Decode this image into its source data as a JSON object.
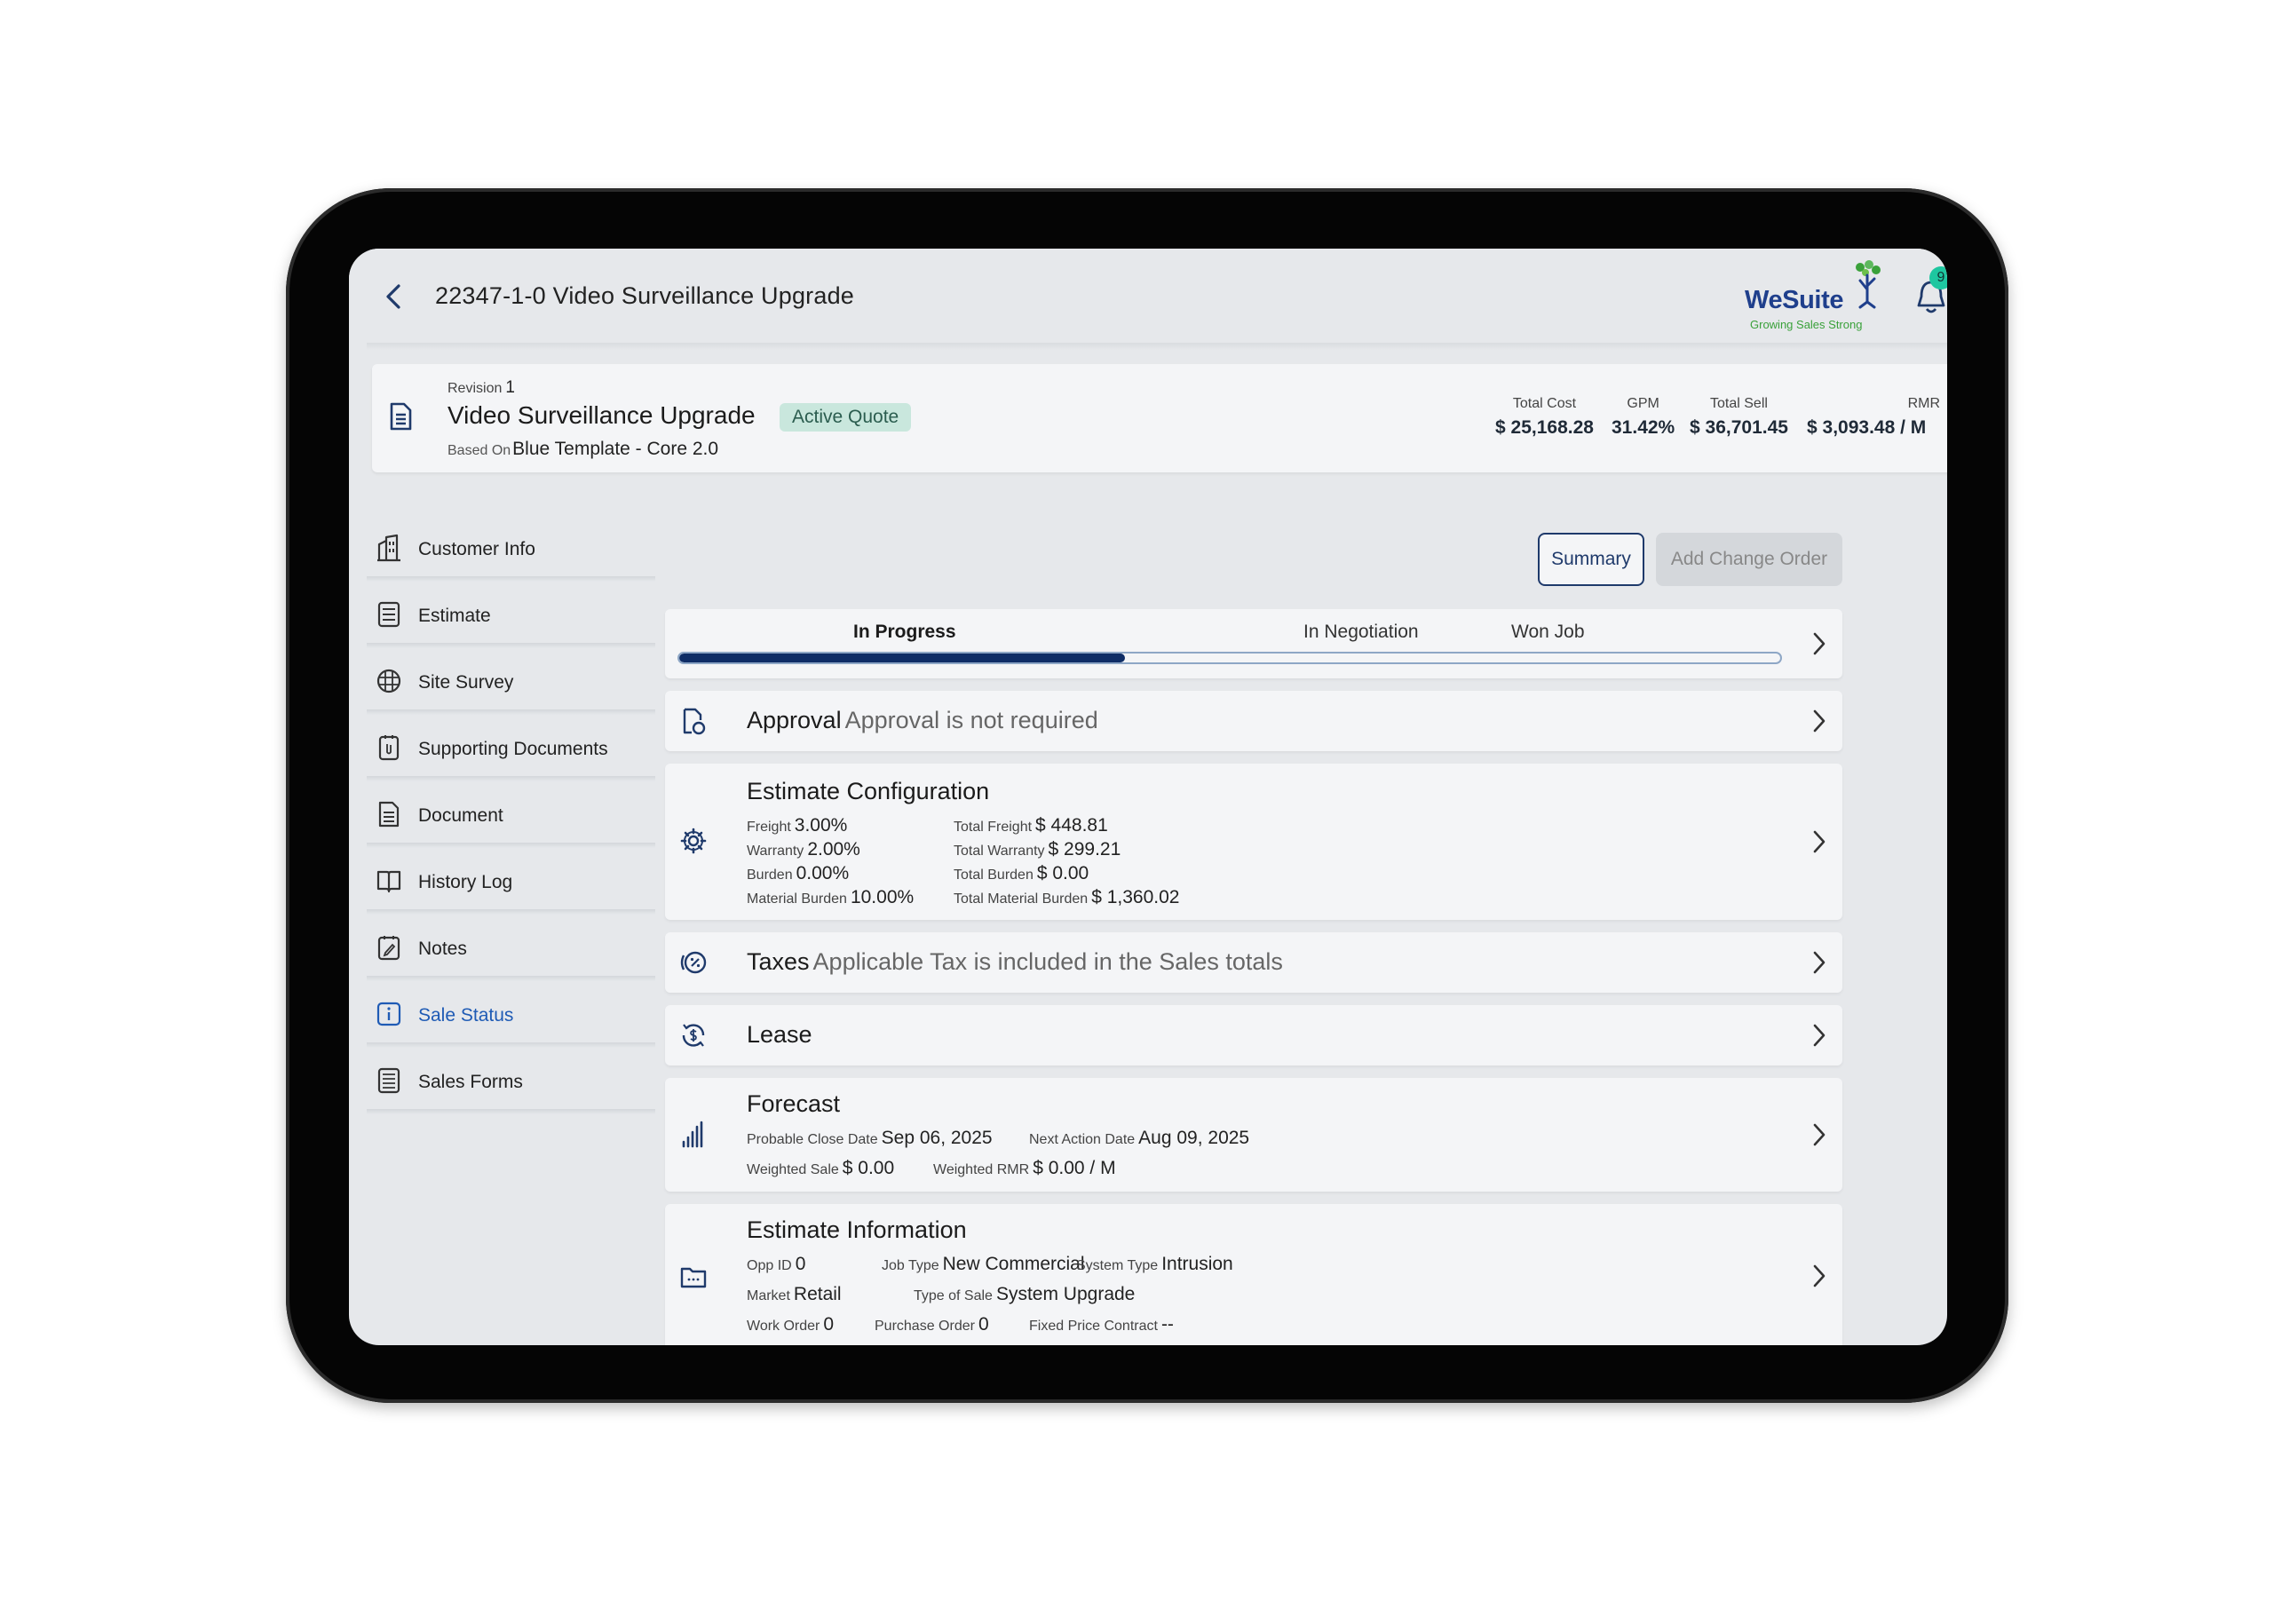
{
  "header": {
    "title": "22347-1-0 Video Surveillance Upgrade",
    "logo_name": "WeSuite",
    "logo_tagline": "Growing Sales Strong",
    "notification_count": "9"
  },
  "revision": {
    "label": "Revision",
    "number": "1",
    "name": "Video Surveillance Upgrade",
    "status_badge": "Active Quote",
    "based_on_label": "Based On",
    "based_on_value": "Blue Template - Core 2.0",
    "totals": [
      {
        "label": "Total Cost",
        "value": "$ 25,168.28"
      },
      {
        "label": "GPM",
        "value": "31.42%"
      },
      {
        "label": "Total Sell",
        "value": "$ 36,701.45"
      },
      {
        "label": "RMR",
        "value": "$ 3,093.48 / M"
      }
    ]
  },
  "sidebar": {
    "items": [
      {
        "label": "Customer Info",
        "icon": "building-icon"
      },
      {
        "label": "Estimate",
        "icon": "calculator-icon"
      },
      {
        "label": "Site Survey",
        "icon": "globe-grid-icon"
      },
      {
        "label": "Supporting Documents",
        "icon": "paperclip-document-icon"
      },
      {
        "label": "Document",
        "icon": "document-icon"
      },
      {
        "label": "History Log",
        "icon": "book-icon"
      },
      {
        "label": "Notes",
        "icon": "notepad-icon"
      },
      {
        "label": "Sale Status",
        "icon": "info-icon"
      },
      {
        "label": "Sales Forms",
        "icon": "form-icon"
      }
    ],
    "active_index": 7
  },
  "actions": {
    "summary_label": "Summary",
    "change_order_label": "Add Change Order"
  },
  "progress": {
    "stages": [
      "In Progress",
      "In Negotiation",
      "Won Job"
    ],
    "current_stage": "In Progress",
    "fill_fraction": 0.405
  },
  "cards": {
    "approval": {
      "title": "Approval",
      "subtitle": "Approval is not required"
    },
    "estimate_config": {
      "title": "Estimate Configuration",
      "left": [
        {
          "k": "Freight",
          "v": "3.00%"
        },
        {
          "k": "Warranty",
          "v": "2.00%"
        },
        {
          "k": "Burden",
          "v": "0.00%"
        },
        {
          "k": "Material Burden",
          "v": "10.00%"
        }
      ],
      "right": [
        {
          "k": "Total Freight",
          "v": "$ 448.81"
        },
        {
          "k": "Total Warranty",
          "v": "$ 299.21"
        },
        {
          "k": "Total Burden",
          "v": "$ 0.00"
        },
        {
          "k": "Total Material Burden",
          "v": "$ 1,360.02"
        }
      ]
    },
    "taxes": {
      "title": "Taxes",
      "subtitle": "Applicable Tax is included in the Sales totals"
    },
    "lease": {
      "title": "Lease"
    },
    "forecast": {
      "title": "Forecast",
      "probable_close_k": "Probable Close Date",
      "probable_close_v": "Sep 06, 2025",
      "next_action_k": "Next Action Date",
      "next_action_v": "Aug 09, 2025",
      "weighted_sale_k": "Weighted Sale",
      "weighted_sale_v": "$ 0.00",
      "weighted_rmr_k": "Weighted RMR",
      "weighted_rmr_v": "$ 0.00 / M"
    },
    "estimate_info": {
      "title": "Estimate Information",
      "opp_id_k": "Opp ID",
      "opp_id_v": "0",
      "job_type_k": "Job Type",
      "job_type_v": "New Commercial",
      "system_type_k": "System Type",
      "system_type_v": "Intrusion",
      "market_k": "Market",
      "market_v": "Retail",
      "type_of_sale_k": "Type of Sale",
      "type_of_sale_v": "System Upgrade",
      "work_order_k": "Work Order",
      "work_order_v": "0",
      "purchase_order_k": "Purchase Order",
      "purchase_order_v": "0",
      "fixed_price_k": "Fixed Price Contract",
      "fixed_price_v": "--"
    }
  },
  "colors": {
    "accent": "#0f2d66",
    "active_nav": "#1f5bb5",
    "badge_bg": "#c9e7dd",
    "logo_blue": "#1f3f8c",
    "logo_green": "#3aa13a"
  }
}
